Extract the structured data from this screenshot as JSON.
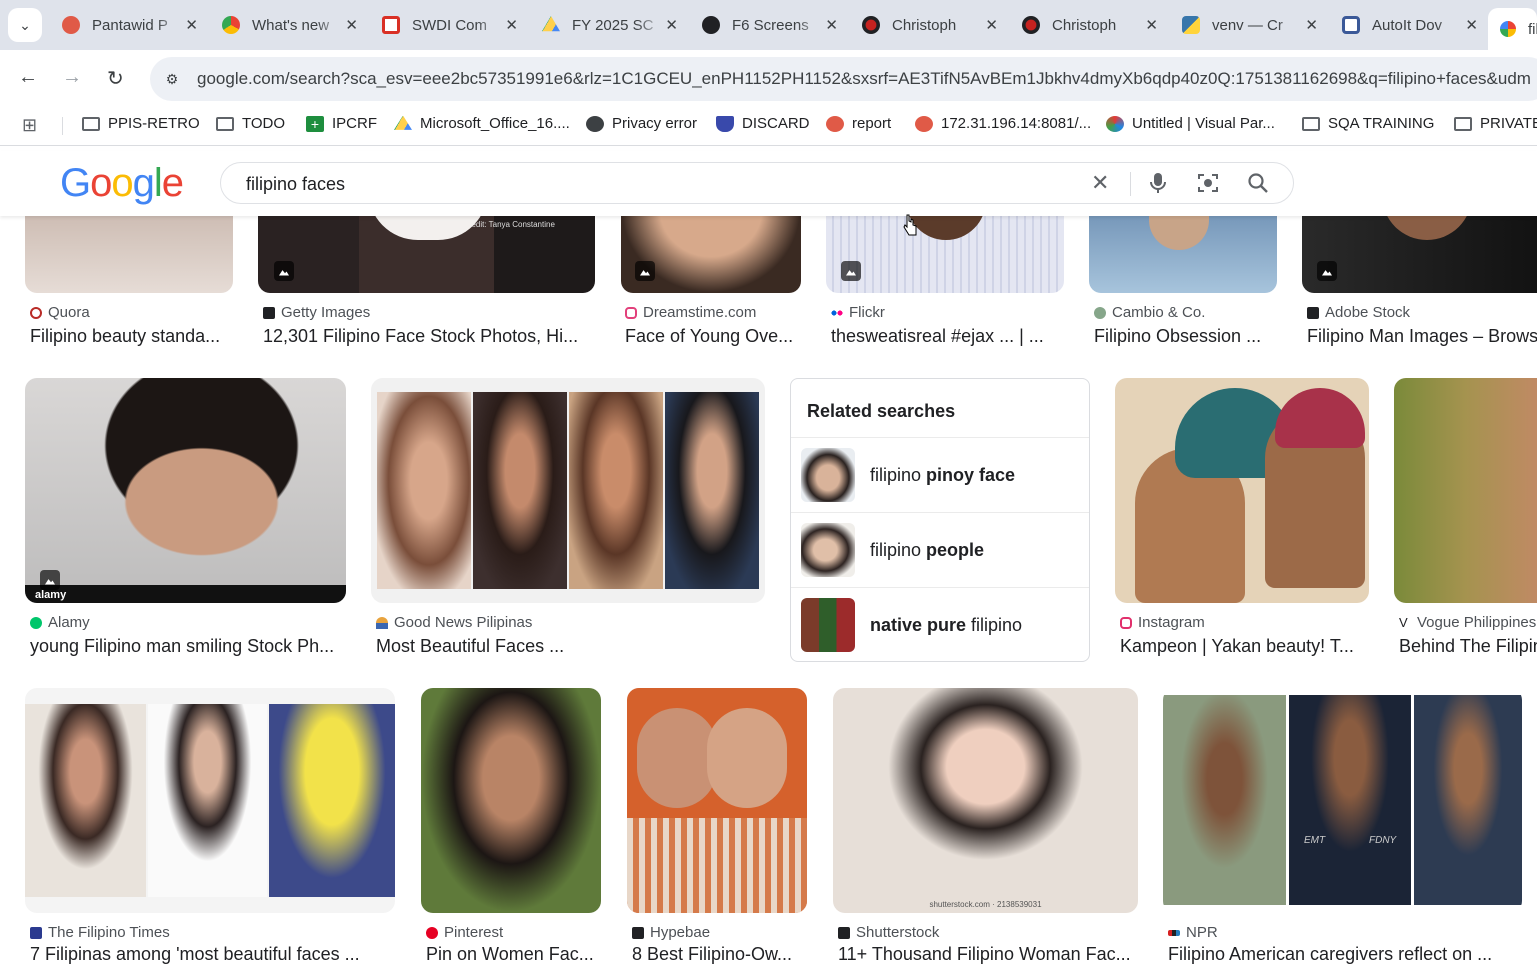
{
  "browser": {
    "tabs": [
      {
        "title": "Pantawid P",
        "icon": "heart-icon",
        "color": "#e05a47"
      },
      {
        "title": "What's new",
        "icon": "chrome-icon",
        "color": "#4285f4"
      },
      {
        "title": "SWDI Com",
        "icon": "gmail-icon",
        "color": "#d93025"
      },
      {
        "title": "FY 2025 SC",
        "icon": "drive-icon",
        "color": "#1fa463"
      },
      {
        "title": "F6 Screens",
        "icon": "openai-icon",
        "color": "#202124"
      },
      {
        "title": "Christoph",
        "icon": "video-icon",
        "color": "#c5221f"
      },
      {
        "title": "Christoph",
        "icon": "video-icon",
        "color": "#c5221f"
      },
      {
        "title": "venv — Cr",
        "icon": "python-icon",
        "color": "#3776ab"
      },
      {
        "title": "AutoIt Dov",
        "icon": "autoit-icon",
        "color": "#3b5998"
      },
      {
        "title": "fil",
        "icon": "google-icon",
        "color": "#4285f4"
      }
    ],
    "url": "google.com/search?sca_esv=eee2bc57351991e6&rlz=1C1GCEU_enPH1152PH1152&sxsrf=AE3TifN5AvBEm1Jbkhv4dmyXb6qdp40z0Q:1751381162698&q=filipino+faces&udm",
    "bookmarks": [
      {
        "label": "PPIS-RETRO",
        "icon": "folder-icon"
      },
      {
        "label": "TODO",
        "icon": "folder-icon"
      },
      {
        "label": "IPCRF",
        "icon": "plus-icon"
      },
      {
        "label": "Microsoft_Office_16....",
        "icon": "drive-icon"
      },
      {
        "label": "Privacy error",
        "icon": "globe-icon"
      },
      {
        "label": "DISCARD",
        "icon": "shield-icon"
      },
      {
        "label": "report",
        "icon": "heart-icon"
      },
      {
        "label": "172.31.196.14:8081/...",
        "icon": "heart-icon"
      },
      {
        "label": "Untitled | Visual Par...",
        "icon": "paradigm-icon"
      },
      {
        "label": "SQA TRAINING",
        "icon": "folder-icon"
      },
      {
        "label": "PRIVATE",
        "icon": "folder-icon"
      }
    ]
  },
  "google": {
    "logo": "Google",
    "query": "filipino faces"
  },
  "results": {
    "row1": [
      {
        "source": "Quora",
        "title": "Filipino beauty standa...",
        "fav": "#b92b27"
      },
      {
        "source": "Getty Images",
        "title": "12,301 Filipino Face Stock Photos, Hi...",
        "fav": "#202124"
      },
      {
        "source": "Dreamstime.com",
        "title": "Face of Young Ove...",
        "fav": "#e2407b"
      },
      {
        "source": "Flickr",
        "title": "thesweatisreal #ejax ... | ...",
        "fav": "#0063dc"
      },
      {
        "source": "Cambio & Co.",
        "title": "Filipino Obsession ...",
        "fav": "#86a68a"
      },
      {
        "source": "Adobe Stock",
        "title": "Filipino Man Images – Browse",
        "fav": "#202124"
      }
    ],
    "row1_watermark": "Credit: Tanya Constantine",
    "row2": [
      {
        "source": "Alamy",
        "title": "young Filipino man smiling Stock Ph...",
        "fav": "#00c66b"
      },
      {
        "source": "Good News Pilipinas",
        "title": "Most Beautiful Faces ...",
        "fav": "#e8a33d"
      },
      {
        "source": "Instagram",
        "title": "Kampeon | Yakan beauty! T...",
        "fav": "#e1306c"
      },
      {
        "source": "Vogue Philippines",
        "title": "Behind The Filipino",
        "fav": "#202124"
      }
    ],
    "row3": [
      {
        "source": "The Filipino Times",
        "title": "7 Filipinas among 'most beautiful faces ...",
        "fav": "#2b3a8f"
      },
      {
        "source": "Pinterest",
        "title": "Pin on Women Fac...",
        "fav": "#e60023"
      },
      {
        "source": "Hypebae",
        "title": "8 Best Filipino-Ow...",
        "fav": "#202124"
      },
      {
        "source": "Shutterstock",
        "title": "11+ Thousand Filipino Woman Fac...",
        "fav": "#202124"
      },
      {
        "source": "NPR",
        "title": "Filipino American caregivers reflect on ...",
        "fav": "#d62021"
      }
    ],
    "shutterstock_watermark": "shutterstock.com · 2138539031",
    "npr_scrubs": [
      "EMT",
      "FDNY"
    ],
    "alamy_watermark": "alamy"
  },
  "related": {
    "heading": "Related searches",
    "items": [
      {
        "plain": "filipino ",
        "bold": "pinoy face",
        "tail": ""
      },
      {
        "plain": "filipino ",
        "bold": "people",
        "tail": ""
      },
      {
        "plain": "",
        "bold": "native pure",
        "tail": " filipino"
      }
    ]
  }
}
